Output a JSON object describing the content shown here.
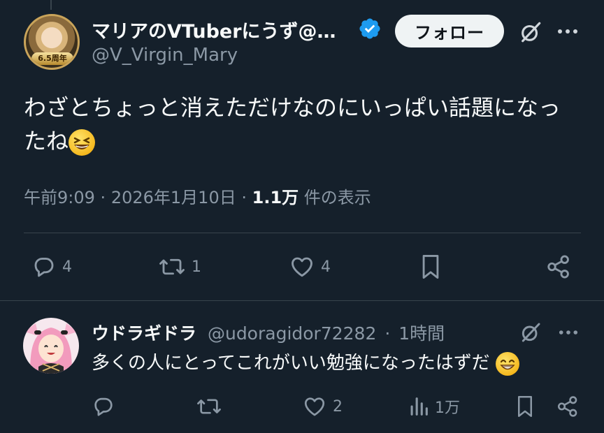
{
  "tweet": {
    "author_name": "マリアのVTuberにうず@…",
    "author_handle": "@V_Virgin_Mary",
    "avatar_badge": "6.5周年",
    "follow_label": "フォロー",
    "text": "わざとちょっと消えただけなのにいっぱい話題になったね",
    "emoji": "grinning-squinting-face",
    "time": "午前9:09",
    "dot1": "·",
    "date": "2026年1月10日",
    "dot2": "·",
    "views_value": "1.1万",
    "views_label": "件の表示",
    "reply_count": "4",
    "retweet_count": "1",
    "like_count": "4"
  },
  "reply": {
    "author_name": "ウドラギドラ",
    "author_handle": "@udoragidor72282",
    "dot": "·",
    "time": "1時間",
    "text": "多くの人にとってこれがいい勉強になったはずだ",
    "emoji": "beaming-face",
    "reply_count": "",
    "retweet_count": "",
    "like_count": "2",
    "views": "1万"
  },
  "colors": {
    "background": "#15202b",
    "text_primary": "#f7f9f9",
    "text_secondary": "#8b98a5",
    "verified": "#1d9bf0",
    "follow_bg": "#eff3f4",
    "divider": "#38444d"
  }
}
